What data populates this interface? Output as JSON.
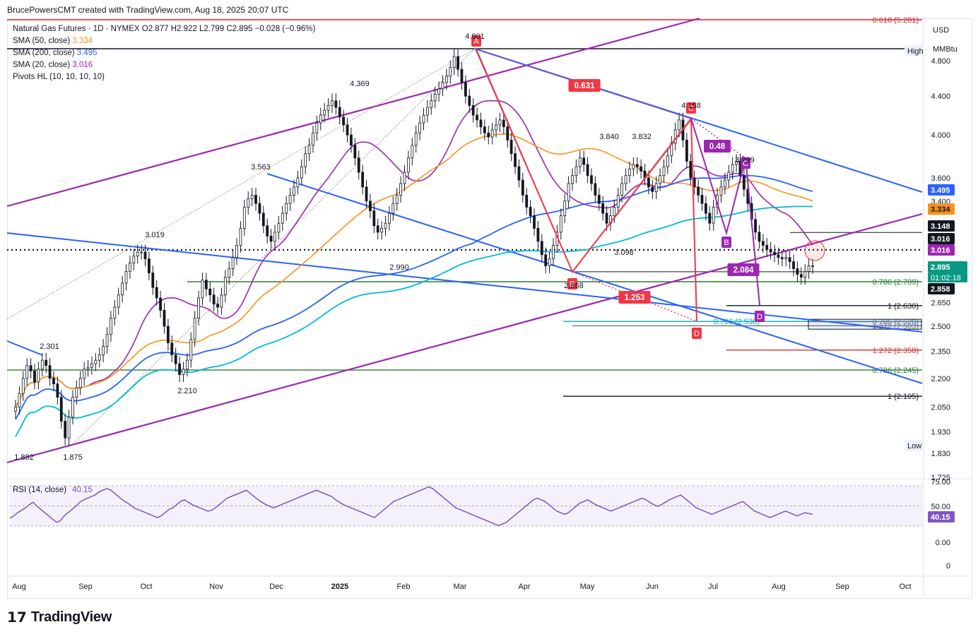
{
  "header": {
    "credit": "BrucePowersCMT created with TradingView.com, Aug 18, 2025 20:07 UTC"
  },
  "legend": {
    "symbol": "Natural Gas Futures · 1D · NYMEX  O2.877  H2.922  L2.799  C2.895  −0.028 (−0.96%)",
    "sma50_label": "SMA (50, close)",
    "sma50_value": "3.334",
    "sma200_label": "SMA (200, close)",
    "sma200_value": "3.495",
    "sma20_label": "SMA (20, close)",
    "sma20_value": "3.016",
    "pivots_label": "Pivots HL (10, 10, 10, 10)"
  },
  "axis": {
    "currency": "USD",
    "unit": "MMBtu"
  },
  "footer": {
    "brand": "TradingView"
  },
  "colors": {
    "up": "#089981",
    "down": "#f23645",
    "candle": "#131722",
    "sma50": "#f7931a",
    "sma200": "#2962ff",
    "sma20": "#9c27b0",
    "sma_teal": "#00bcd4",
    "trend_blue": "#2962ff",
    "trend_purple": "#9c27b0",
    "fib_green": "#2e7d32",
    "fib_red": "#d32f2f",
    "pattern_red": "#f23645",
    "rsi_line": "#7e57c2"
  },
  "chart_data": {
    "type": "candlestick",
    "symbol": "Natural Gas Futures",
    "interval": "1D",
    "exchange": "NYMEX",
    "price_scale": "log",
    "y_ticks": [
      4.8,
      4.4,
      4.0,
      3.6,
      3.4,
      2.65,
      2.5,
      2.35,
      2.2,
      2.05,
      1.93,
      1.83,
      1.725
    ],
    "y_tick_labels": [
      "4.800",
      "4.400",
      "4.000",
      "3.600",
      "3.400",
      "2.650",
      "2.500",
      "2.350",
      "2.200",
      "2.050",
      "1.930",
      "1.830",
      "1.725"
    ],
    "x_labels": [
      "Aug",
      "Sep",
      "Oct",
      "Nov",
      "Dec",
      "2025",
      "Feb",
      "Mar",
      "Apr",
      "May",
      "Jun",
      "Jul",
      "Aug",
      "Sep",
      "Oct"
    ],
    "ohlc_last": {
      "open": 2.877,
      "high": 2.922,
      "low": 2.799,
      "close": 2.895,
      "change": -0.028,
      "change_pct": -0.96
    },
    "countdown": "01:02:18",
    "price_tags": [
      {
        "label": "High",
        "value": "",
        "kind": "ghost"
      },
      {
        "label": "",
        "value": "3.495",
        "kind": "sma200"
      },
      {
        "label": "",
        "value": "3.334",
        "kind": "sma50"
      },
      {
        "label": "",
        "value": "3.148",
        "kind": "black"
      },
      {
        "label": "",
        "value": "3.016",
        "kind": "black"
      },
      {
        "label": "",
        "value": "3.016",
        "kind": "sma20"
      },
      {
        "label": "",
        "value": "2.895",
        "kind": "last"
      },
      {
        "label": "",
        "value": "2.858",
        "kind": "black"
      },
      {
        "label": "Low",
        "value": "1.875",
        "kind": "ghost"
      }
    ],
    "swing_labels": [
      {
        "text": "4.901",
        "price": 4.901,
        "date": "2025-03"
      },
      {
        "text": "4.369",
        "price": 4.369,
        "date": "2024-12"
      },
      {
        "text": "4.158",
        "price": 4.158,
        "date": "2025-06"
      },
      {
        "text": "3.840",
        "price": 3.84,
        "date": "2025-05"
      },
      {
        "text": "3.832",
        "price": 3.832,
        "date": "2025-06"
      },
      {
        "text": "3.799",
        "price": 3.799,
        "date": "2025-07"
      },
      {
        "text": "3.563",
        "price": 3.563,
        "date": "2024-11"
      },
      {
        "text": "3.098",
        "price": 3.098,
        "date": "2025-05"
      },
      {
        "text": "3.019",
        "price": 3.019,
        "date": "2024-09"
      },
      {
        "text": "2.990",
        "price": 2.99,
        "date": "2025-01"
      },
      {
        "text": "2.868",
        "price": 2.868,
        "date": "2025-04"
      },
      {
        "text": "2.301",
        "price": 2.301,
        "date": "2024-08"
      },
      {
        "text": "2.210",
        "price": 2.21,
        "date": "2024-10"
      },
      {
        "text": "1.882",
        "price": 1.882,
        "date": "2024-08"
      },
      {
        "text": "1.875",
        "price": 1.875,
        "date": "2024-08"
      }
    ],
    "pattern_points": [
      {
        "label": "A",
        "pattern": "red"
      },
      {
        "label": "B",
        "pattern": "red"
      },
      {
        "label": "C",
        "pattern": "red"
      },
      {
        "label": "D",
        "pattern": "red"
      },
      {
        "label": "B",
        "pattern": "purple"
      },
      {
        "label": "C",
        "pattern": "purple"
      },
      {
        "label": "D",
        "pattern": "purple"
      }
    ],
    "ratio_labels": [
      {
        "text": "0.631",
        "color": "red"
      },
      {
        "text": "1.253",
        "color": "red"
      },
      {
        "text": "0.48",
        "color": "purple"
      },
      {
        "text": "2.084",
        "color": "purple"
      }
    ],
    "fib_levels": [
      {
        "text": "0.618 (5.281)",
        "price": 5.281,
        "color": "red"
      },
      {
        "text": "0.786 (2.789)",
        "price": 2.789,
        "color": "green"
      },
      {
        "text": "1 (2.630)",
        "price": 2.63,
        "color": "black"
      },
      {
        "text": "0.786 (2.530)",
        "price": 2.53,
        "color": "teal"
      },
      {
        "text": "0.786 (2.528)",
        "price": 2.528,
        "color": "gray"
      },
      {
        "text": "1.272 (2.503)",
        "price": 2.503,
        "color": "gray"
      },
      {
        "text": "1.272 (2.358)",
        "price": 2.358,
        "color": "red"
      },
      {
        "text": "0.786 (2.245)",
        "price": 2.245,
        "color": "green"
      },
      {
        "text": "1 (2.105)",
        "price": 2.105,
        "color": "black"
      }
    ],
    "close_series": [
      2.05,
      2.12,
      2.2,
      2.27,
      2.24,
      2.18,
      2.25,
      2.3,
      2.27,
      2.2,
      2.17,
      2.1,
      1.98,
      1.9,
      2.0,
      2.1,
      2.15,
      2.2,
      2.25,
      2.26,
      2.28,
      2.3,
      2.33,
      2.38,
      2.45,
      2.55,
      2.62,
      2.7,
      2.78,
      2.86,
      2.92,
      2.97,
      3.0,
      3.0,
      2.95,
      2.85,
      2.75,
      2.68,
      2.6,
      2.5,
      2.4,
      2.33,
      2.28,
      2.22,
      2.25,
      2.3,
      2.42,
      2.55,
      2.68,
      2.8,
      2.74,
      2.7,
      2.64,
      2.62,
      2.7,
      2.82,
      2.88,
      2.96,
      3.05,
      3.18,
      3.35,
      3.42,
      3.45,
      3.38,
      3.3,
      3.2,
      3.12,
      3.08,
      3.15,
      3.22,
      3.3,
      3.38,
      3.45,
      3.52,
      3.6,
      3.7,
      3.82,
      3.9,
      4.02,
      4.12,
      4.2,
      4.25,
      4.3,
      4.35,
      4.28,
      4.18,
      4.1,
      4.0,
      3.9,
      3.78,
      3.65,
      3.52,
      3.4,
      3.32,
      3.2,
      3.15,
      3.18,
      3.22,
      3.3,
      3.38,
      3.45,
      3.55,
      3.65,
      3.78,
      3.9,
      4.02,
      4.12,
      4.2,
      4.28,
      4.35,
      4.42,
      4.48,
      4.55,
      4.62,
      4.72,
      4.85,
      4.7,
      4.55,
      4.4,
      4.3,
      4.2,
      4.15,
      4.08,
      4.02,
      3.98,
      4.05,
      4.1,
      4.15,
      4.08,
      3.95,
      3.82,
      3.7,
      3.58,
      3.45,
      3.35,
      3.28,
      3.18,
      3.08,
      2.98,
      2.9,
      2.95,
      3.05,
      3.15,
      3.28,
      3.4,
      3.55,
      3.62,
      3.7,
      3.78,
      3.72,
      3.62,
      3.55,
      3.45,
      3.38,
      3.3,
      3.22,
      3.28,
      3.35,
      3.45,
      3.55,
      3.62,
      3.68,
      3.72,
      3.7,
      3.66,
      3.6,
      3.52,
      3.48,
      3.55,
      3.62,
      3.7,
      3.8,
      3.92,
      4.05,
      4.15,
      3.95,
      3.75,
      3.6,
      3.52,
      3.45,
      3.38,
      3.3,
      3.22,
      3.35,
      3.45,
      3.52,
      3.58,
      3.65,
      3.72,
      3.75,
      3.62,
      3.5,
      3.38,
      3.25,
      3.15,
      3.08,
      3.05,
      3.02,
      3.0,
      2.98,
      2.96,
      2.95,
      2.96,
      2.93,
      2.88,
      2.84,
      2.82,
      2.86,
      2.9,
      2.895
    ],
    "sma_series_order": [
      "sma20",
      "sma50",
      "sma200",
      "sma_teal"
    ],
    "rsi": {
      "label": "RSI (14, close)",
      "value": "40.15",
      "levels": [
        75,
        50,
        25
      ],
      "tick_labels": [
        "75.00",
        "50.00",
        "0.00",
        "0"
      ],
      "series": [
        35,
        38,
        42,
        45,
        48,
        52,
        55,
        50,
        46,
        42,
        38,
        34,
        30,
        32,
        38,
        42,
        46,
        50,
        55,
        58,
        60,
        62,
        64,
        68,
        70,
        72,
        70,
        66,
        62,
        58,
        55,
        52,
        48,
        46,
        44,
        42,
        40,
        38,
        36,
        38,
        42,
        46,
        48,
        52,
        56,
        58,
        55,
        52,
        50,
        48,
        46,
        44,
        45,
        48,
        52,
        56,
        60,
        62,
        64,
        66,
        68,
        70,
        66,
        62,
        58,
        55,
        52,
        50,
        48,
        50,
        52,
        54,
        56,
        58,
        60,
        62,
        64,
        66,
        68,
        70,
        68,
        66,
        64,
        62,
        58,
        55,
        52,
        50,
        48,
        46,
        44,
        42,
        40,
        38,
        36,
        40,
        44,
        48,
        52,
        56,
        58,
        60,
        62,
        64,
        66,
        68,
        70,
        72,
        74,
        72,
        68,
        64,
        60,
        56,
        52,
        48,
        46,
        44,
        42,
        40,
        38,
        36,
        34,
        32,
        30,
        28,
        26,
        28,
        30,
        34,
        38,
        42,
        46,
        50,
        54,
        58,
        60,
        58,
        56,
        52,
        48,
        44,
        42,
        40,
        42,
        46,
        50,
        54,
        56,
        58,
        55,
        52,
        50,
        48,
        46,
        44,
        46,
        48,
        50,
        52,
        54,
        56,
        58,
        60,
        58,
        55,
        52,
        50,
        52,
        55,
        58,
        60,
        62,
        64,
        60,
        56,
        52,
        48,
        46,
        44,
        42,
        40,
        42,
        44,
        46,
        48,
        50,
        52,
        54,
        56,
        52,
        48,
        44,
        42,
        40,
        38,
        36,
        38,
        40,
        42,
        44,
        42,
        40,
        38,
        40,
        42,
        41,
        40.15
      ]
    }
  }
}
